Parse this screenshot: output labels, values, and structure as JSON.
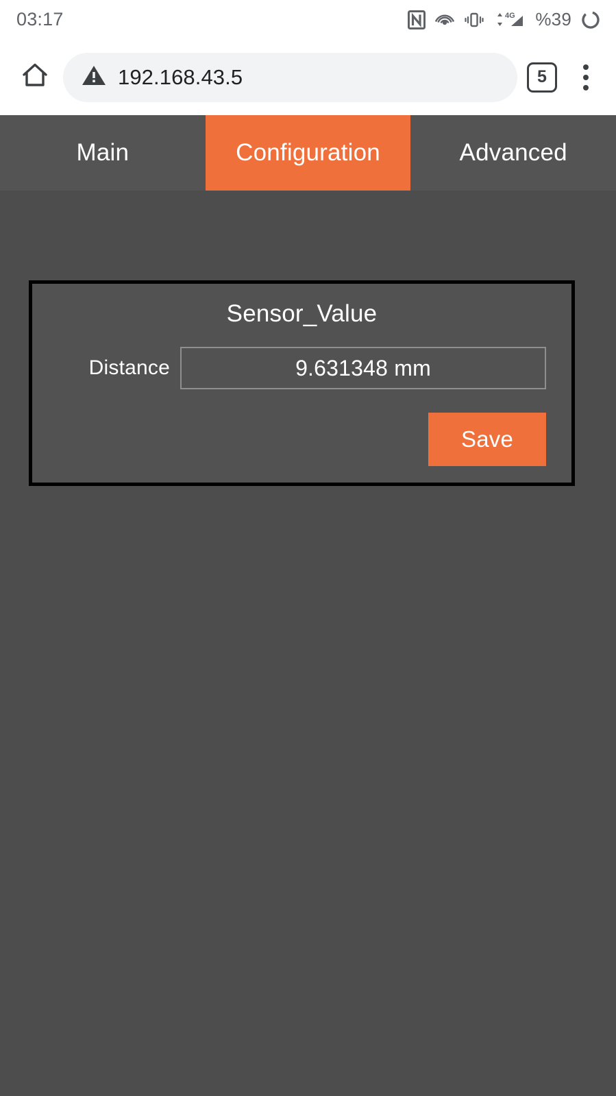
{
  "status_bar": {
    "clock": "03:17",
    "battery_text": "%39",
    "icons": [
      "nfc-icon",
      "hotspot-icon",
      "vibrate-icon",
      "signal-4g-icon",
      "battery-ring-icon"
    ]
  },
  "browser": {
    "home_icon": "home-icon",
    "security_icon": "warning-triangle-icon",
    "url": "192.168.43.5",
    "tab_count": "5",
    "menu_icon": "overflow-menu-icon"
  },
  "tabs": [
    {
      "label": "Main",
      "active": false
    },
    {
      "label": "Configuration",
      "active": true
    },
    {
      "label": "Advanced",
      "active": false
    }
  ],
  "card": {
    "title": "Sensor_Value",
    "field_label": "Distance",
    "field_value": "9.631348 mm",
    "save_label": "Save"
  },
  "colors": {
    "accent_orange": "#f0703c",
    "tabbar_gray": "#545454",
    "page_gray": "#4d4d4d",
    "card_gray": "#525252",
    "card_border": "#000000",
    "omnibox_gray": "#f1f3f4",
    "text_white": "#ffffff",
    "status_icon_gray": "#5f6368"
  }
}
